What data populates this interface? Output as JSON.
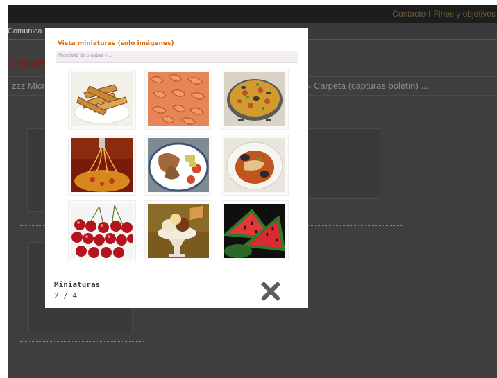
{
  "background_page": {
    "top_nav": {
      "links": [
        "Contacto",
        "Fines y objetivos"
      ],
      "separator": "I"
    },
    "sub_nav": {
      "item": "Comunica"
    },
    "page_title": "Carpe",
    "breadcrumb_left": "zzz Micr",
    "breadcrumb_right": "» Carpeta (capturas boletín) ..."
  },
  "modal": {
    "title": "Vista miniaturas (solo imágenes)",
    "subtitle": "MicroWeb de pruebas » ...",
    "thumbnails": [
      {
        "icon": "churros-photo"
      },
      {
        "icon": "shrimp-photo"
      },
      {
        "icon": "paella-photo"
      },
      {
        "icon": "spaghetti-photo"
      },
      {
        "icon": "roast-chicken-photo"
      },
      {
        "icon": "fish-soup-photo"
      },
      {
        "icon": "cherries-photo"
      },
      {
        "icon": "ice-cream-photo"
      },
      {
        "icon": "watermelon-photo"
      }
    ],
    "footer": {
      "label": "Miniaturas",
      "counter": "2 / 4"
    },
    "close_icon": "close-icon"
  },
  "colors": {
    "modal_title": "#d46a0c",
    "overlay": "#3e3e3e",
    "bg_title": "#8a1616"
  }
}
